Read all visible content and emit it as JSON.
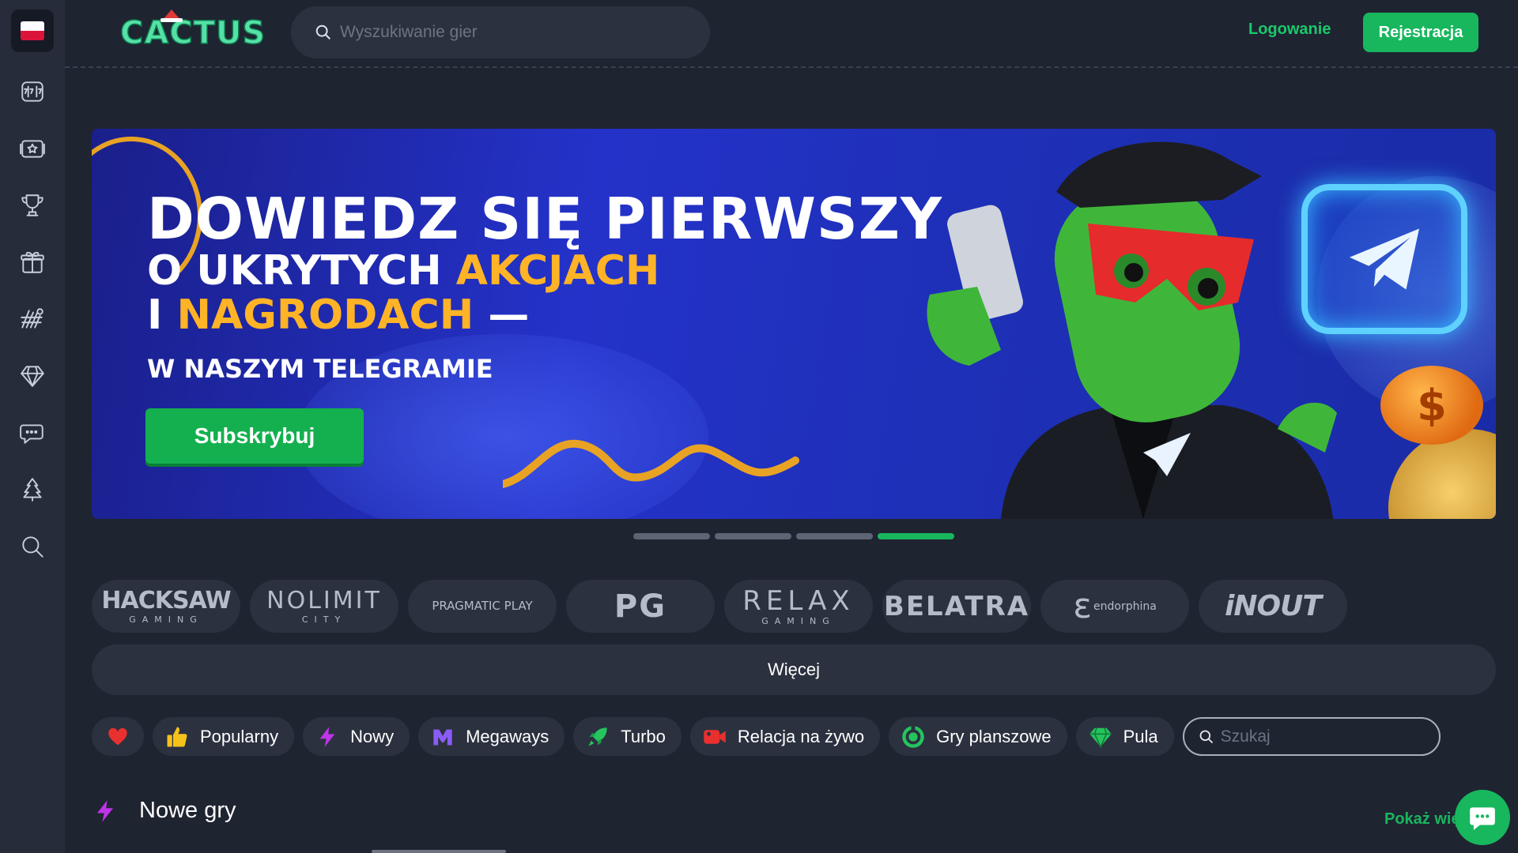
{
  "brand": {
    "logo_text": "CACTUS"
  },
  "header": {
    "search_placeholder": "Wyszukiwanie gier",
    "login_label": "Logowanie",
    "register_label": "Rejestracja"
  },
  "sidebar": {
    "language": "PL",
    "items": [
      {
        "icon": "slot-machine-icon"
      },
      {
        "icon": "live-casino-icon"
      },
      {
        "icon": "trophy-icon"
      },
      {
        "icon": "gift-box-icon"
      },
      {
        "icon": "sports-icon"
      },
      {
        "icon": "diamond-icon"
      },
      {
        "icon": "chat-icon"
      },
      {
        "icon": "christmas-tree-icon"
      },
      {
        "icon": "search-icon"
      }
    ]
  },
  "banner": {
    "line1": "DOWIEDZ SIĘ PIERWSZY",
    "line2_white": "O UKRYTYCH ",
    "line2_gold": "AKCJACH",
    "line3_white": "I ",
    "line3_gold": "NAGRODACH",
    "line3_dash": " —",
    "line4": "W NASZYM TELEGRAMIE",
    "button_label": "Subskrybuj",
    "slides_total": 4,
    "active_slide": 4
  },
  "providers": [
    {
      "name": "HACKSAW",
      "sub": "GAMING"
    },
    {
      "name": "NOLIMIT",
      "sub": "CITY"
    },
    {
      "name": "PRAGMATIC PLAY",
      "sub": ""
    },
    {
      "name": "PG",
      "sub": ""
    },
    {
      "name": "RELAX",
      "sub": "GAMING"
    },
    {
      "name": "BELATRA",
      "sub": ""
    },
    {
      "name": "endorphina",
      "sub": ""
    },
    {
      "name": "iNOUT",
      "sub": ""
    }
  ],
  "more_label": "Więcej",
  "categories": [
    {
      "label": "",
      "icon": "heart-icon",
      "color": "#e8302f"
    },
    {
      "label": "Popularny",
      "icon": "thumbs-up-icon",
      "color": "#f6c21a"
    },
    {
      "label": "Nowy",
      "icon": "lightning-icon",
      "color": "#c034e8"
    },
    {
      "label": "Megaways",
      "icon": "megaways-icon",
      "color": "#8a5cf5"
    },
    {
      "label": "Turbo",
      "icon": "rocket-icon",
      "color": "#25c45e"
    },
    {
      "label": "Relacja na żywo",
      "icon": "live-camera-icon",
      "color": "#e8302f"
    },
    {
      "label": "Gry planszowe",
      "icon": "board-games-icon",
      "color": "#25c45e"
    },
    {
      "label": "Pula",
      "icon": "jackpot-diamond-icon",
      "color": "#25c45e"
    }
  ],
  "category_search_placeholder": "Szukaj",
  "section": {
    "title": "Nowe gry",
    "show_more": "Pokaż wię"
  },
  "colors": {
    "accent": "#18b75e",
    "background": "#1f2431",
    "sidebar": "#262c3a",
    "chip": "#2b313f"
  }
}
